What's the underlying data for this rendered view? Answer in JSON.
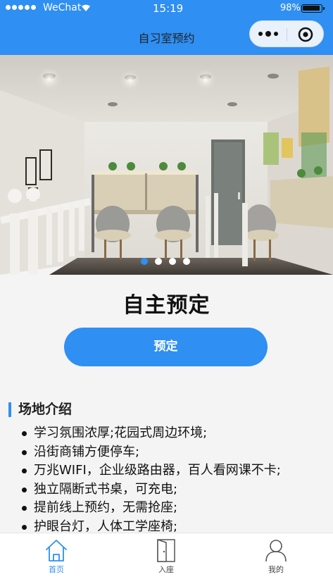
{
  "status_bar": {
    "carrier": "WeChat",
    "time": "15:19",
    "battery": "98%"
  },
  "nav": {
    "title": "自习室预约"
  },
  "banner": {
    "slides": 4,
    "active_index": 0
  },
  "main": {
    "headline": "自主预定",
    "book_button": "预定",
    "section_title": "场地介绍",
    "features": [
      "学习氛围浓厚;花园式周边环境;",
      "沿街商铺方便停车;",
      "万兆WIFI，企业级路由器，百人看网课不卡;",
      "独立隔断式书桌，可充电;",
      "提前线上预约，无需抢座;",
      "护眼台灯，人体工学座椅;"
    ]
  },
  "tab_bar": {
    "items": [
      {
        "label": "首页",
        "icon": "home-icon",
        "active": true
      },
      {
        "label": "入座",
        "icon": "door-icon",
        "active": false
      },
      {
        "label": "我的",
        "icon": "user-icon",
        "active": false
      }
    ]
  },
  "colors": {
    "brand": "#2f8ff2",
    "background": "#f4f4f4"
  }
}
